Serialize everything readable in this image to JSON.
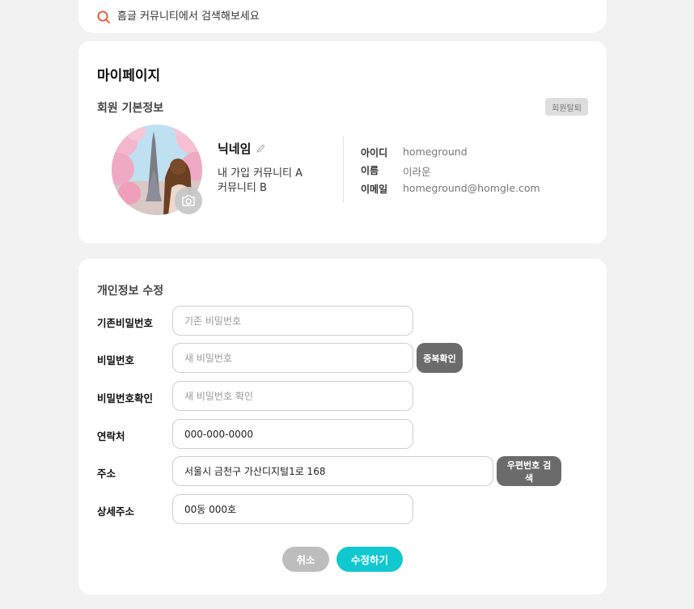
{
  "search": {
    "placeholder": "흠글 커뮤니티에서 검색해보세요",
    "icon": "search-icon",
    "accent_color": "#e8502a"
  },
  "profile": {
    "page_title": "마이페이지",
    "section_title": "회원 기본정보",
    "withdraw_label": "회원탈퇴",
    "nickname": "닉네임",
    "community_primary": "내 가입 커뮤니티 A",
    "community_secondary": "커뮤니티 B",
    "info": [
      {
        "label": "아이디",
        "value": "homeground"
      },
      {
        "label": "이름",
        "value": "이라운"
      },
      {
        "label": "이메일",
        "value": "homeground@homgle.com"
      }
    ]
  },
  "edit": {
    "title": "개인정보 수정",
    "fields": [
      {
        "label": "기존비밀번호",
        "value": "",
        "placeholder": "기존 비밀번호"
      },
      {
        "label": "비밀번호",
        "value": "",
        "placeholder": "새 비밀번호"
      },
      {
        "label": "비밀번호확인",
        "value": "",
        "placeholder": "새 비밀번호 확인"
      },
      {
        "label": "연락처",
        "value": "000-000-0000",
        "placeholder": ""
      },
      {
        "label": "주소",
        "value": "서울시 금천구 가산디지털1로 168",
        "placeholder": ""
      },
      {
        "label": "상세주소",
        "value": "00동 000호",
        "placeholder": ""
      }
    ],
    "duplicate_check_label": "중복확인",
    "zipcode_search_label": "우편번호 검색",
    "cancel_label": "취소",
    "submit_label": "수정하기"
  },
  "colors": {
    "background": "#f2f2f2",
    "card": "#ffffff",
    "primary": "#11c7d0",
    "secondary_button": "#6b6b6b",
    "cancel_button": "#bdbdbd"
  }
}
